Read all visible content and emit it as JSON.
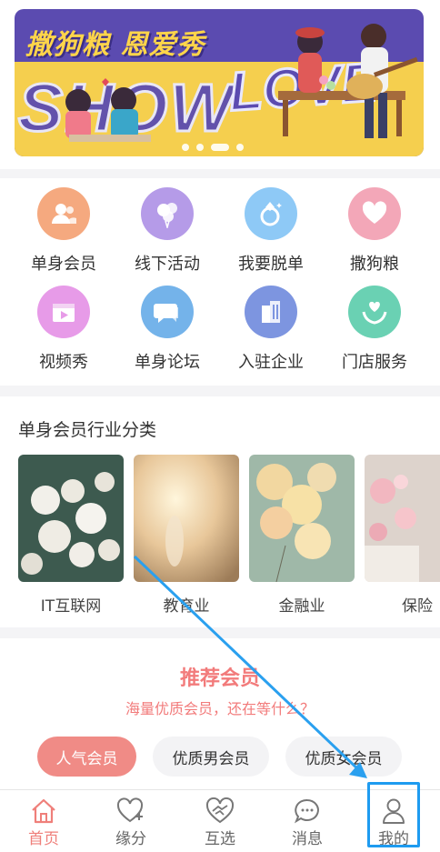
{
  "banner": {
    "title": "撒狗粮 恩爱秀",
    "word1": "SHOW",
    "word2": "LOVE",
    "slide_count": 4,
    "active_slide": 3
  },
  "menu": {
    "items": [
      {
        "label": "单身会员",
        "icon": "members-icon",
        "color": "#f5a97f"
      },
      {
        "label": "线下活动",
        "icon": "balloons-icon",
        "color": "#b59be8"
      },
      {
        "label": "我要脱单",
        "icon": "ring-icon",
        "color": "#8ec9f6"
      },
      {
        "label": "撒狗粮",
        "icon": "heart-icon",
        "color": "#f3a7b8"
      },
      {
        "label": "视频秀",
        "icon": "video-icon",
        "color": "#e79be8"
      },
      {
        "label": "单身论坛",
        "icon": "chat-icon",
        "color": "#74b3ea"
      },
      {
        "label": "入驻企业",
        "icon": "building-icon",
        "color": "#7d95e0"
      },
      {
        "label": "门店服务",
        "icon": "service-icon",
        "color": "#6ad1b3"
      }
    ]
  },
  "industry": {
    "title": "单身会员行业分类",
    "cards": [
      {
        "caption": "IT互联网"
      },
      {
        "caption": "教育业"
      },
      {
        "caption": "金融业"
      },
      {
        "caption": "保险"
      }
    ]
  },
  "recommend": {
    "title": "推荐会员",
    "subtitle": "海量优质会员，还在等什么？",
    "filters": [
      {
        "label": "人气会员",
        "active": true
      },
      {
        "label": "优质男会员",
        "active": false
      },
      {
        "label": "优质女会员",
        "active": false
      }
    ]
  },
  "tabbar": {
    "tabs": [
      {
        "label": "首页",
        "icon": "home-icon",
        "active": true
      },
      {
        "label": "缘分",
        "icon": "heart-plus-icon",
        "active": false
      },
      {
        "label": "互选",
        "icon": "handshake-icon",
        "active": false
      },
      {
        "label": "消息",
        "icon": "message-icon",
        "active": false
      },
      {
        "label": "我的",
        "icon": "user-icon",
        "active": false
      }
    ]
  },
  "colors": {
    "accent": "#ef7f7a",
    "highlight": "#1e9bf0",
    "banner_purple": "#5b4bb0",
    "banner_yellow": "#f5cf4e"
  }
}
